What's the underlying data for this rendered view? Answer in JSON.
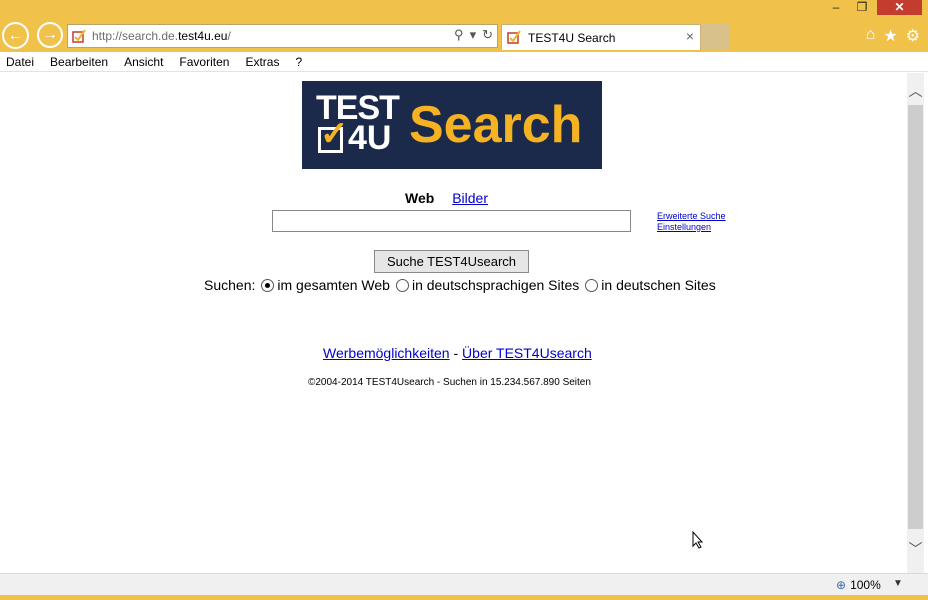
{
  "browser": {
    "url_prefix": "http://search.de.",
    "url_domain": "test4u.eu",
    "url_suffix": "/",
    "tab_title": "TEST4U Search",
    "tab_close": "×",
    "minimize": "–",
    "maximize": "❐",
    "close": "✕"
  },
  "menu": {
    "items": [
      "Datei",
      "Bearbeiten",
      "Ansicht",
      "Favoriten",
      "Extras",
      "?"
    ]
  },
  "logo": {
    "line1": "TEST",
    "line2": "4U",
    "check": "✓",
    "search": "Search"
  },
  "search": {
    "tab_web": "Web",
    "tab_images": "Bilder",
    "input_value": "",
    "advanced_link": "Erweiterte Suche",
    "settings_link": "Einstellungen",
    "button_label": "Suche TEST4Usearch",
    "scope_label": "Suchen:",
    "scope_options": [
      {
        "label": "im gesamten Web",
        "selected": true
      },
      {
        "label": "in deutschsprachigen Sites",
        "selected": false
      },
      {
        "label": "in deutschen Sites",
        "selected": false
      }
    ]
  },
  "footer": {
    "ads_link": "Werbemöglichkeiten",
    "separator": "-",
    "about_link": "Über TEST4Usearch",
    "copyright": "©2004-2014 TEST4Usearch - Suchen in 15.234.567.890 Seiten"
  },
  "status": {
    "zoom": "100%"
  },
  "colors": {
    "chrome_yellow": "#f1c24a",
    "logo_navy": "#1b2a4a",
    "logo_orange": "#f5b324",
    "link_blue": "#0000cc"
  },
  "icons": [
    "back-icon",
    "forward-icon",
    "search-icon",
    "dropdown-icon",
    "refresh-icon",
    "home-icon",
    "star-icon",
    "gear-icon",
    "zoom-icon"
  ]
}
